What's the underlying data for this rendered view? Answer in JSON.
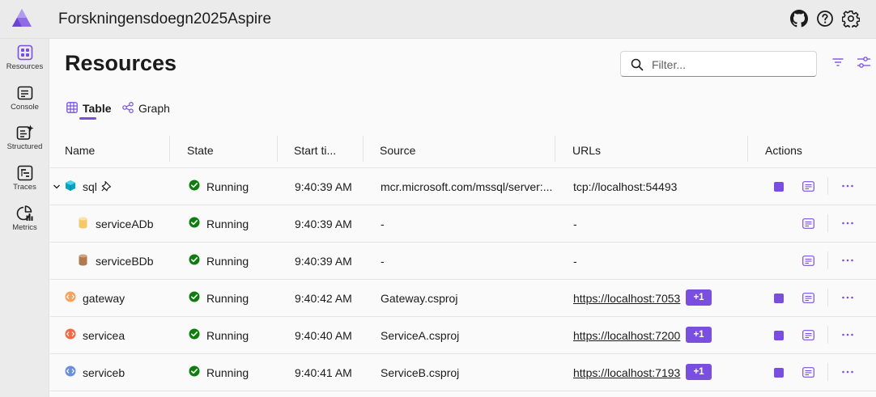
{
  "app": {
    "title": "Forskningensdoegn2025Aspire"
  },
  "topbar": {
    "icons": [
      "github-icon",
      "help-icon",
      "settings-icon"
    ]
  },
  "sidebar": {
    "items": [
      {
        "label": "Resources",
        "icon": "resources-icon",
        "active": true
      },
      {
        "label": "Console",
        "icon": "console-icon"
      },
      {
        "label": "Structured",
        "icon": "structured-icon"
      },
      {
        "label": "Traces",
        "icon": "traces-icon"
      },
      {
        "label": "Metrics",
        "icon": "metrics-icon"
      }
    ]
  },
  "page": {
    "title": "Resources"
  },
  "filter": {
    "placeholder": "Filter..."
  },
  "tabs": [
    {
      "label": "Table",
      "active": true
    },
    {
      "label": "Graph",
      "active": false
    }
  ],
  "table": {
    "columns": [
      "Name",
      "State",
      "Start ti...",
      "Source",
      "URLs",
      "Actions"
    ],
    "rows": [
      {
        "name": "sql",
        "state": "Running",
        "start": "9:40:39 AM",
        "source": "mcr.microsoft.com/mssql/server:...",
        "url": "tcp://localhost:54493",
        "badge": "",
        "icon": "container-icon",
        "expandable": true,
        "pinned": true,
        "stoppable": true
      },
      {
        "name": "serviceADb",
        "state": "Running",
        "start": "9:40:39 AM",
        "source": "-",
        "url": "-",
        "badge": "",
        "icon": "database-icon",
        "child": true
      },
      {
        "name": "serviceBDb",
        "state": "Running",
        "start": "9:40:39 AM",
        "source": "-",
        "url": "-",
        "badge": "",
        "icon": "database-icon",
        "child": true
      },
      {
        "name": "gateway",
        "state": "Running",
        "start": "9:40:42 AM",
        "source": "Gateway.csproj",
        "url": "https://localhost:7053",
        "badge": "+1",
        "icon": "project-icon",
        "stoppable": true
      },
      {
        "name": "servicea",
        "state": "Running",
        "start": "9:40:40 AM",
        "source": "ServiceA.csproj",
        "url": "https://localhost:7200",
        "badge": "+1",
        "icon": "project-icon",
        "stoppable": true
      },
      {
        "name": "serviceb",
        "state": "Running",
        "start": "9:40:41 AM",
        "source": "ServiceB.csproj",
        "url": "https://localhost:7193",
        "badge": "+1",
        "icon": "project-icon",
        "stoppable": true
      }
    ]
  },
  "colors": {
    "accent": "#7a4fe0",
    "running": "#107c10",
    "sql": "#00a6c4",
    "db_a": "#f5c96a",
    "db_b": "#b07a4e",
    "gateway": "#f7a35c",
    "servicea": "#f06a48",
    "serviceb": "#6a8fe0"
  }
}
